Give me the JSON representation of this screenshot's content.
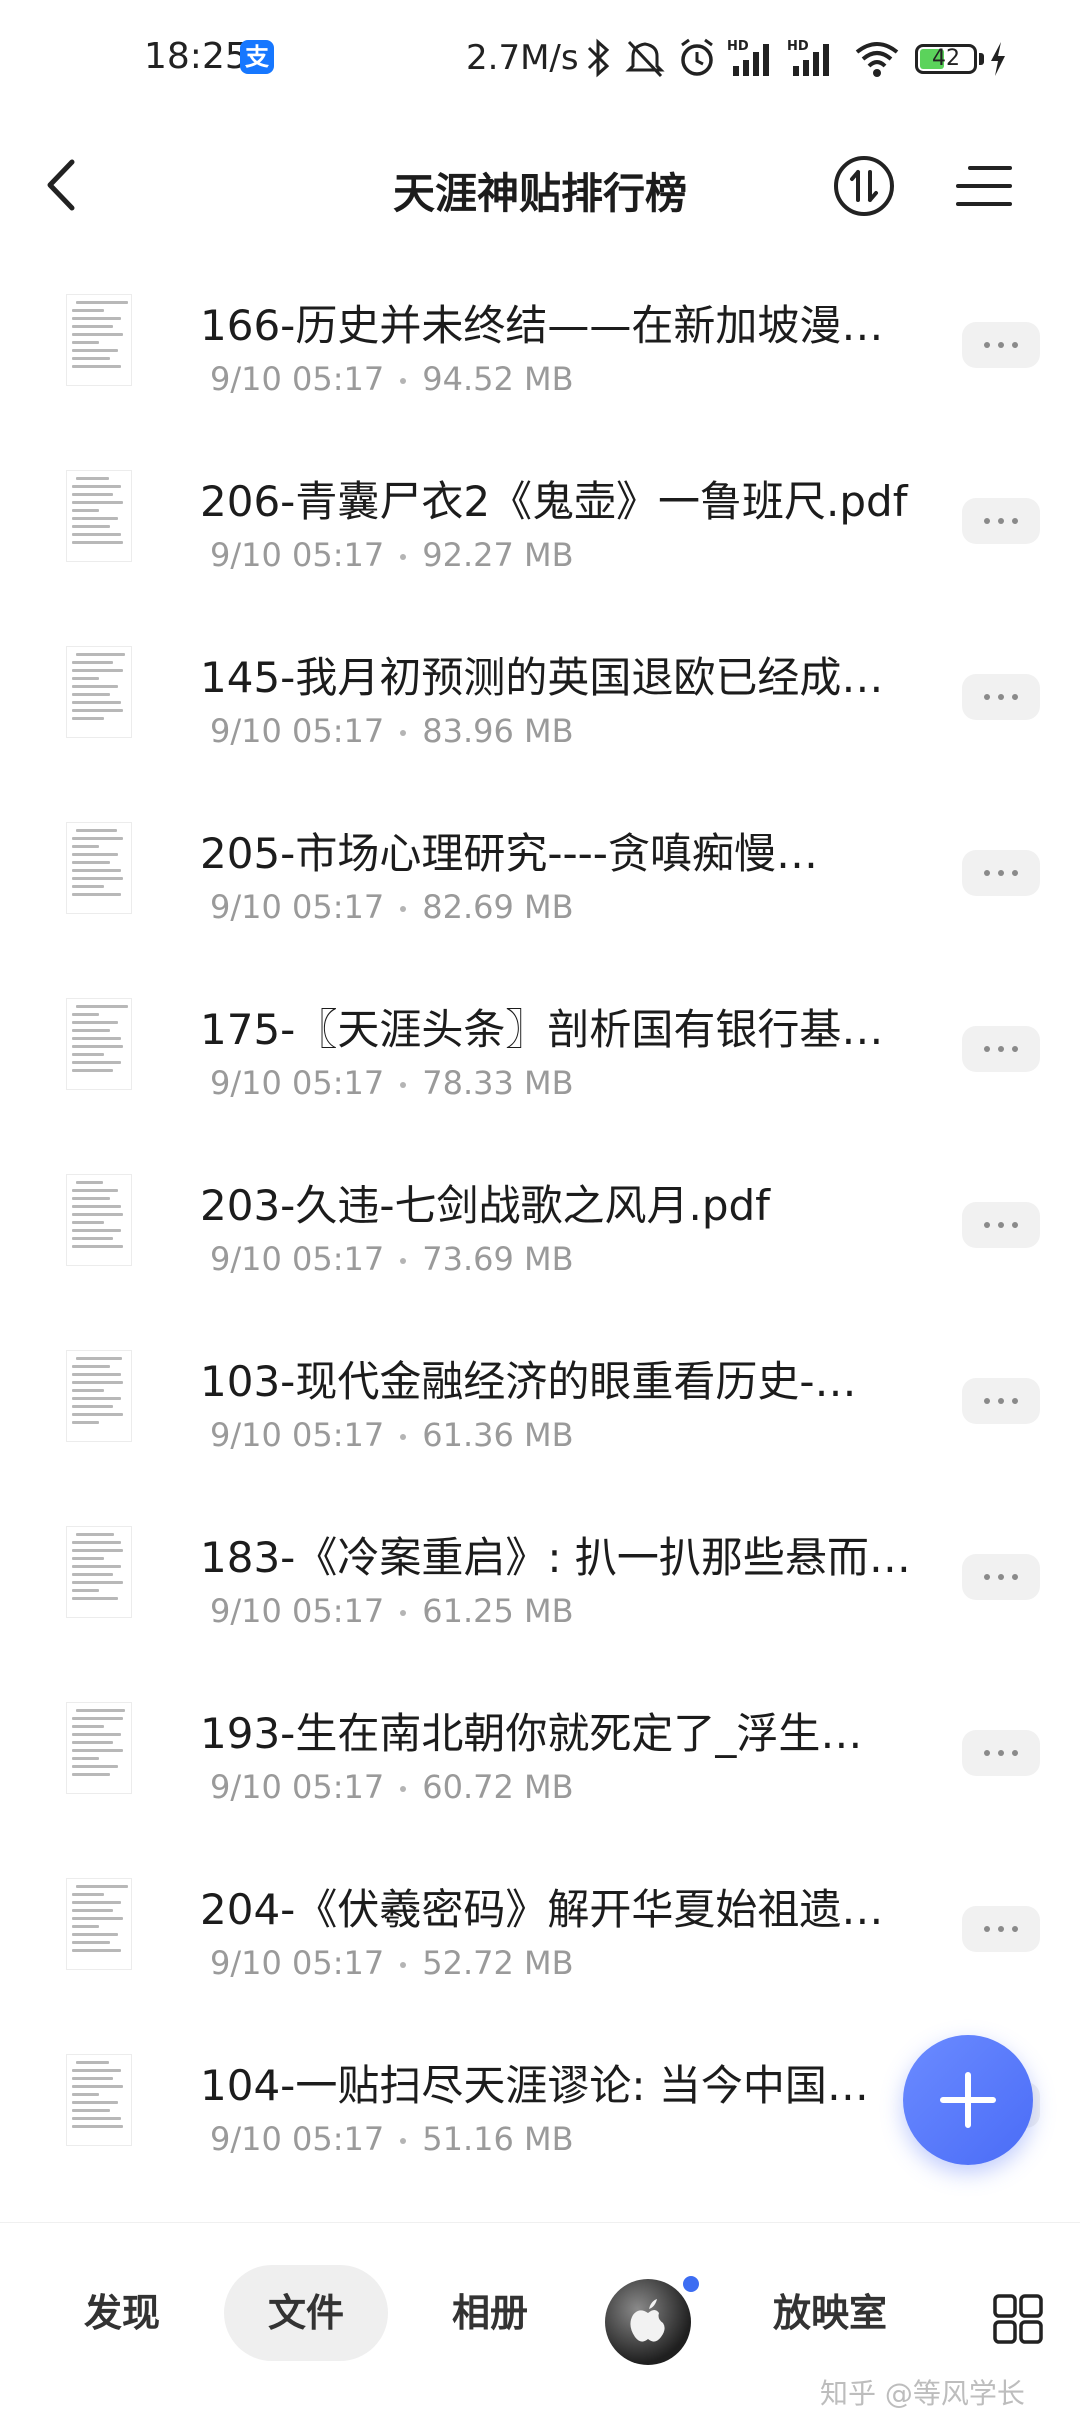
{
  "status_bar": {
    "time": "18:25",
    "alipay_glyph": "支",
    "net_speed": "2.7M/s",
    "battery": "42",
    "icons": [
      "bluetooth-icon",
      "mute-icon",
      "alarm-icon",
      "hd-signal-icon",
      "hd-signal-icon",
      "wifi-icon",
      "battery-icon",
      "charging-icon"
    ]
  },
  "header": {
    "title": "天涯神贴排行榜",
    "back_icon": "chevron-left-icon",
    "sort_icon": "sort-icon",
    "menu_icon": "menu-icon"
  },
  "files": [
    {
      "name": "166-历史并未终结——在新加坡漫…",
      "date": "9/10 05:17",
      "size": "94.52 MB"
    },
    {
      "name": "206-青囊尸衣2《鬼壶》一鲁班尺.pdf",
      "date": "9/10 05:17",
      "size": "92.27 MB"
    },
    {
      "name": "145-我月初预测的英国退欧已经成…",
      "date": "9/10 05:17",
      "size": "83.96 MB"
    },
    {
      "name": "205-市场心理研究----贪嗔痴慢…",
      "date": "9/10 05:17",
      "size": "82.69 MB"
    },
    {
      "name": "175-〖天涯头条〗剖析国有银行基…",
      "date": "9/10 05:17",
      "size": "78.33 MB"
    },
    {
      "name": "203-久违-七剑战歌之风月.pdf",
      "date": "9/10 05:17",
      "size": "73.69 MB"
    },
    {
      "name": "103-现代金融经济的眼重看历史-…",
      "date": "9/10 05:17",
      "size": "61.36 MB"
    },
    {
      "name": "183-《冷案重启》: 扒一扒那些悬而…",
      "date": "9/10 05:17",
      "size": "61.25 MB"
    },
    {
      "name": "193-生在南北朝你就死定了_浮生…",
      "date": "9/10 05:17",
      "size": "60.72 MB"
    },
    {
      "name": "204-《伏羲密码》解开华夏始祖遗…",
      "date": "9/10 05:17",
      "size": "52.72 MB"
    },
    {
      "name": "104-一贴扫尽天涯谬论: 当今中国…",
      "date": "9/10 05:17",
      "size": "51.16 MB"
    }
  ],
  "fab_icon": "plus-icon",
  "bottom_nav": {
    "discover": "发现",
    "files": "文件",
    "photos": "相册",
    "cinema": "放映室",
    "active": "文件",
    "grid_icon": "grid-icon"
  },
  "watermark": "知乎 @等风学长",
  "colors": {
    "accent": "#4a6cf7",
    "meta_text": "#9a9a9a",
    "nav_active_bg": "#efefef"
  }
}
